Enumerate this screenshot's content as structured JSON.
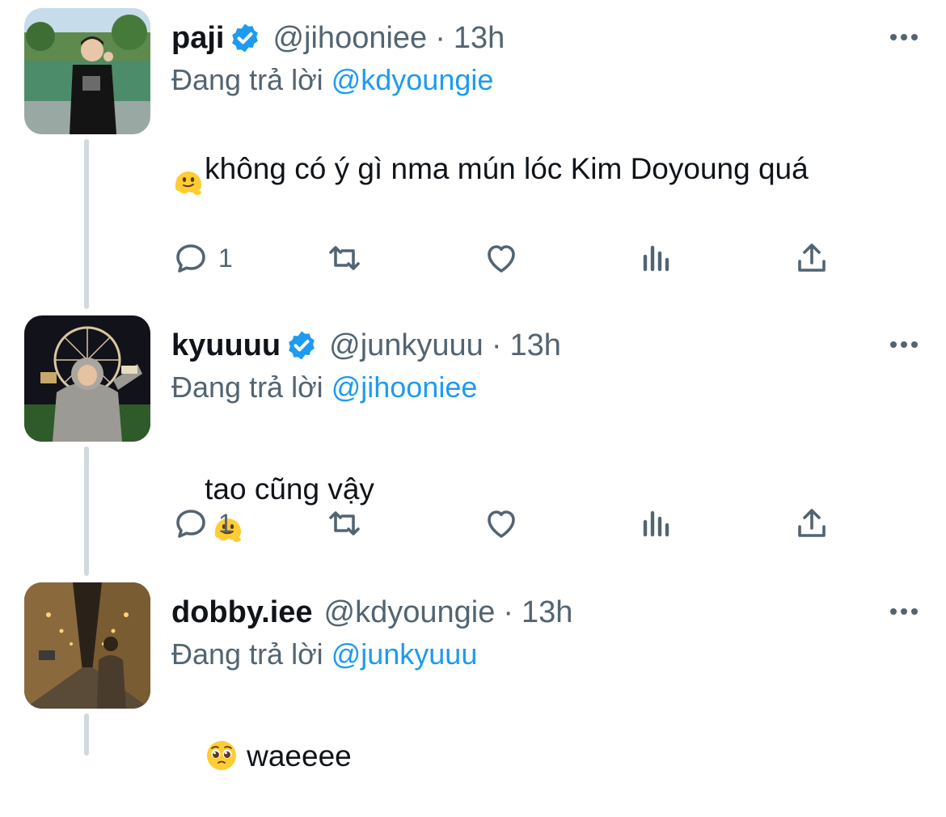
{
  "tweets": [
    {
      "name": "paji",
      "verified": true,
      "handle": "@jihooniee",
      "separator": "·",
      "time": "13h",
      "replying_prefix": "Đang trả lời",
      "replying_to": "@kdyoungie",
      "text": "không có ý gì nma mún lóc Kim Doyoung quá",
      "emoji": "melting-face-emoji",
      "reply_count": "1"
    },
    {
      "name": "kyuuuu",
      "verified": true,
      "handle": "@junkyuuu",
      "separator": "·",
      "time": "13h",
      "replying_prefix": "Đang trả lời",
      "replying_to": "@jihooniee",
      "text": "tao cũng vậy",
      "emoji": "melting-face-emoji",
      "reply_count": "1"
    },
    {
      "name": "dobby.iee",
      "verified": false,
      "handle": "@kdyoungie",
      "separator": "·",
      "time": "13h",
      "replying_prefix": "Đang trả lời",
      "replying_to": "@junkyuuu",
      "emoji": "pleading-face-emoji",
      "text": "waeeee"
    }
  ],
  "colors": {
    "link": "#1d9bf0",
    "secondary_text": "#536471",
    "thread_line": "#cfd9de",
    "verified": "#1d9bf0"
  }
}
